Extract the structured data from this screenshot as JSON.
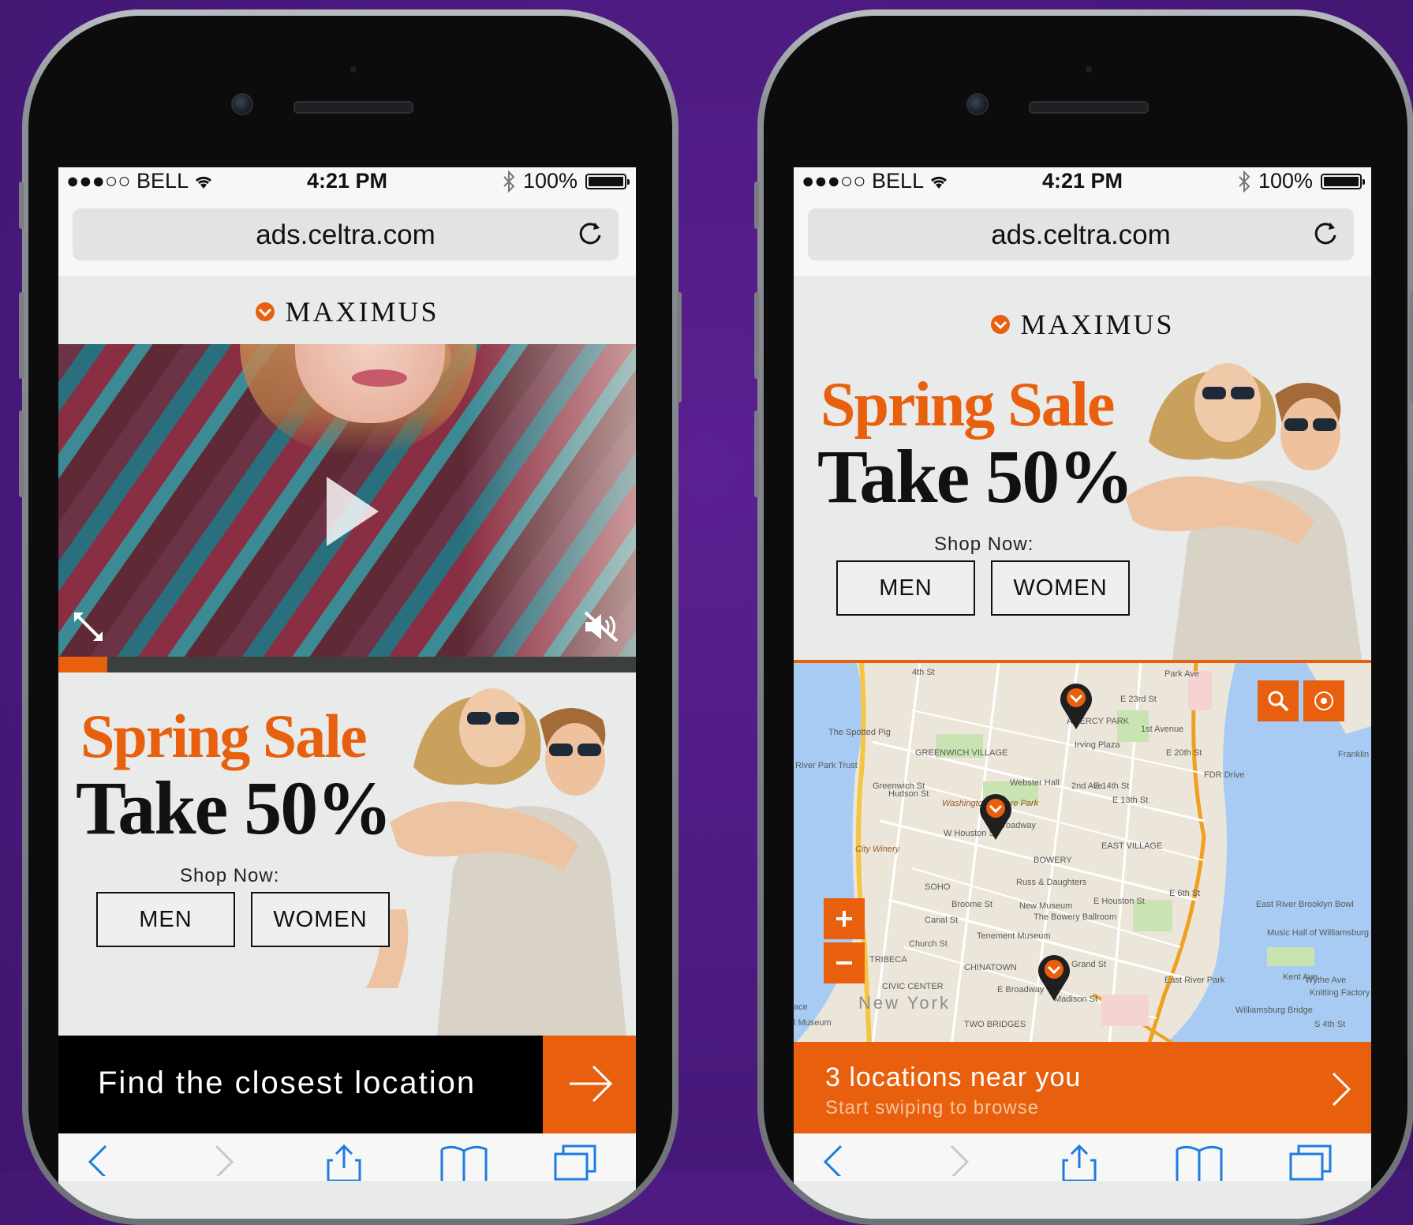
{
  "status_bar": {
    "carrier": "●●●○○ BELL",
    "time": "4:21 PM",
    "battery": "100%"
  },
  "browser": {
    "url": "ads.celtra.com"
  },
  "brand": {
    "name": "MAXIMUS"
  },
  "video": {
    "progress": 0.085
  },
  "promo": {
    "headline_1": "Spring Sale",
    "headline_2": "Take 50%",
    "shop_now": "Shop Now:",
    "men_button": "MEN",
    "women_button": "WOMEN"
  },
  "cta": {
    "label": "Find the closest location"
  },
  "locations": {
    "title": "3 locations near you",
    "subtitle": "Start swiping to browse"
  },
  "map": {
    "labels": [
      "The Spotted Pig",
      "GREENWICH VILLAGE",
      "River Park Trust",
      "Irving Plaza",
      "AMERCY PARK",
      "Webster Hall",
      "Washington Square Park",
      "E 14th St",
      "E 13th St",
      "E 20th St",
      "E 23rd St",
      "1st Avenue",
      "FDR Drive",
      "2nd Ave",
      "EAST VILLAGE",
      "BOWERY",
      "City Winery",
      "W Houston St",
      "Broadway",
      "SOHO",
      "Broome St",
      "Russ & Daughters",
      "E Houston St",
      "E 6th St",
      "New Museum",
      "The Bowery Ballroom",
      "Canal St",
      "Tenement Museum",
      "TRIBECA",
      "Church St",
      "CHINATOWN",
      "Grand St",
      "CIVIC CENTER",
      "E Broadway",
      "Madison St",
      "New York",
      "TWO BRIDGES",
      "East River Park",
      "East River",
      "Brooklyn Bowl",
      "Music Hall of Williamsburg",
      "Kent Ave",
      "Wythe Ave",
      "Knitting Factory",
      "Williamsburg Bridge",
      "S 4th St",
      "Franklin St",
      "Greenwich St",
      "Hudson St",
      "ace",
      "l Museum",
      "4th St",
      "Park Ave"
    ]
  },
  "colors": {
    "accent": "#e8600e",
    "background": "#4a1a7e",
    "ad_background": "#e9ebea"
  }
}
